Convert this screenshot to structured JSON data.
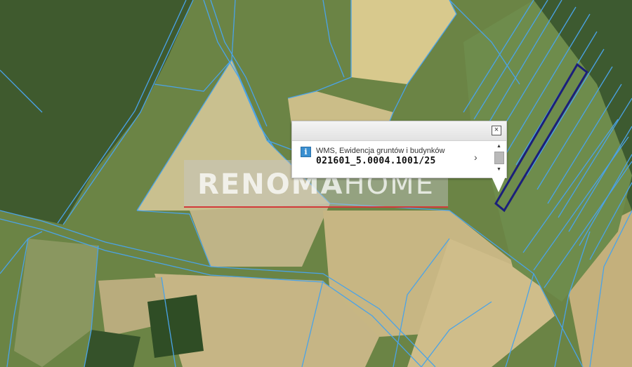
{
  "popup": {
    "layer_label": "WMS, Ewidencja gruntów i budynków",
    "parcel_id": "021601_5.0004.1001/25",
    "close_glyph": "×",
    "next_glyph": "›",
    "info_glyph": "i"
  },
  "watermark": {
    "bold": "RENOMA",
    "light": "HOME"
  },
  "colors": {
    "parcel_lines": "#4aa3e8",
    "selected_parcel": "#1b1f7a",
    "watermark_underline": "#d23a3a"
  }
}
